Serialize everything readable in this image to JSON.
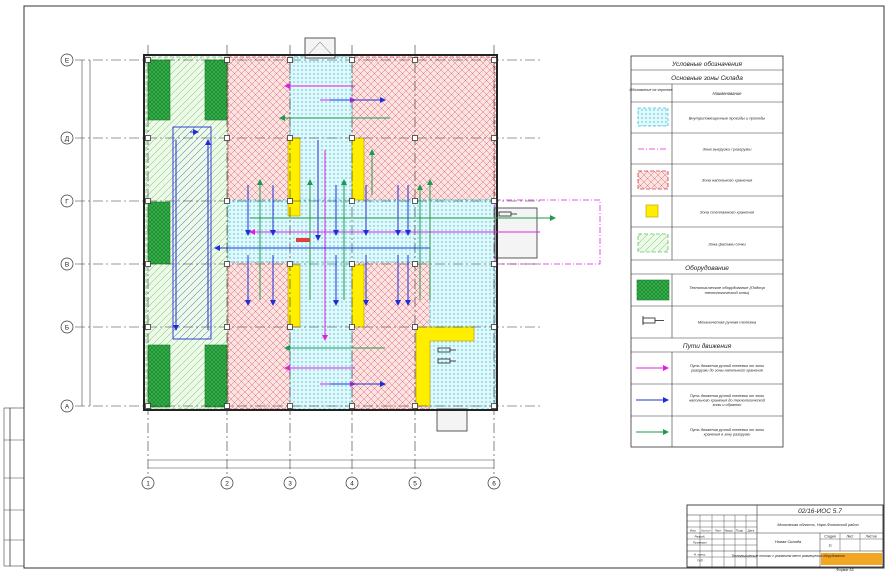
{
  "axes": {
    "rows": [
      "Е",
      "Д",
      "Г",
      "В",
      "Б",
      "А"
    ],
    "cols": [
      "1",
      "2",
      "3",
      "4",
      "5",
      "6"
    ]
  },
  "legend": {
    "title": "Условные обозначения",
    "zones_header": "Основные зоны Склада",
    "col_symbol": "Обозначение на чертеже",
    "col_name": "Наименование",
    "zones": [
      {
        "id": "passages",
        "label": "Внутрипомещенные проезды и проходы"
      },
      {
        "id": "unloading",
        "label": "Зона выгрузки / разгрузки"
      },
      {
        "id": "main-storage",
        "label": "Зона напольного хранения"
      },
      {
        "id": "rack-storage",
        "label": "Зона стеллажного хранения"
      },
      {
        "id": "reserve",
        "label": "Зона фасовки сечки"
      }
    ],
    "equipment_header": "Оборудование",
    "equipment": [
      {
        "id": "tech-equipment",
        "label": "Технологическое оборудование (Подпор технологической зоны)"
      },
      {
        "id": "hand-truck",
        "label": "Механическая ручная тележка"
      }
    ],
    "routes_header": "Пути движения",
    "routes": [
      {
        "id": "route-magenta",
        "label": "Путь движения ручной тележки от зоны разгрузки до зоны напольного хранения"
      },
      {
        "id": "route-blue",
        "label": "Путь движения ручной тележки от зоны напольного хранения до технологической зоны и обратно"
      },
      {
        "id": "route-green",
        "label": "Путь движения ручной тележки от зоны хранения в зону разгрузки"
      }
    ]
  },
  "title_block": {
    "doc_code": "02/16-ИОС 5.7",
    "row_labels": [
      "Изм.",
      "Кол.уч",
      "Лист",
      "№док.",
      "Подп.",
      "Дата"
    ],
    "names": [
      "Разраб.",
      "Проверил",
      "Н. контр.",
      "ГИП"
    ],
    "object": "Московская область, Наро-Фоминский район",
    "sheet_title": "Новая Склада",
    "stage_label": "Стадия",
    "sheet_label": "Лист",
    "sheets_label": "Листов",
    "stage": "П",
    "description": "Технологические потоки с указанием мест размещения оборудования",
    "format": "Формат А3"
  },
  "colors": {
    "magenta": "#e020e0",
    "blue": "#1f2fd8",
    "green": "#1e9a4e",
    "red": "#e04040",
    "cyan": "#35c5d8",
    "yellow": "#ffee00"
  }
}
